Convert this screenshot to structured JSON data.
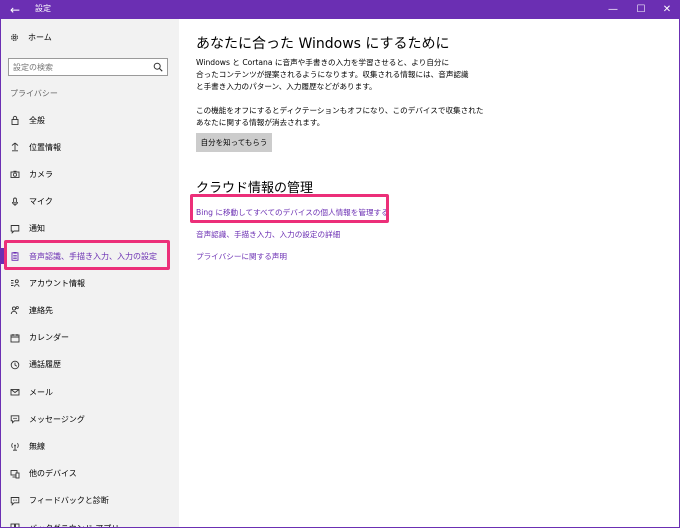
{
  "window": {
    "title": "設定",
    "back_icon": "back-arrow-icon",
    "minimize_icon": "minimize-icon",
    "maximize_icon": "maximize-icon",
    "close_icon": "close-icon",
    "accent": "#6b2fb3",
    "highlight_color": "#ec2f79"
  },
  "sidebar": {
    "home_label": "ホーム",
    "search_placeholder": "設定の検索",
    "section_label": "プライバシー",
    "items": [
      {
        "label": "全般",
        "icon": "lock-icon"
      },
      {
        "label": "位置情報",
        "icon": "location-icon"
      },
      {
        "label": "カメラ",
        "icon": "camera-icon"
      },
      {
        "label": "マイク",
        "icon": "microphone-icon"
      },
      {
        "label": "通知",
        "icon": "notification-icon"
      },
      {
        "label": "音声認識、手描き入力、入力の設定",
        "icon": "clipboard-icon",
        "selected": true
      },
      {
        "label": "アカウント情報",
        "icon": "account-info-icon"
      },
      {
        "label": "連絡先",
        "icon": "contacts-icon"
      },
      {
        "label": "カレンダー",
        "icon": "calendar-icon"
      },
      {
        "label": "通話履歴",
        "icon": "call-history-icon"
      },
      {
        "label": "メール",
        "icon": "mail-icon"
      },
      {
        "label": "メッセージング",
        "icon": "messaging-icon"
      },
      {
        "label": "無線",
        "icon": "radio-icon"
      },
      {
        "label": "他のデバイス",
        "icon": "devices-icon"
      },
      {
        "label": "フィードバックと診断",
        "icon": "feedback-icon"
      },
      {
        "label": "バックグラウンド アプリ",
        "icon": "background-apps-icon"
      }
    ]
  },
  "main": {
    "heading": "あなたに合った Windows にするために",
    "para1": [
      "Windows と Cortana に音声や手書きの入力を学習させると、より自分に",
      "合ったコンテンツが提案されるようになります。収集される情報には、音声認識",
      "と手書き入力のパターン、入力履歴などがあります。"
    ],
    "para2": [
      "この機能をオフにするとディクテーションもオフになり、このデバイスで収集された",
      "あなたに関する情報が消去されます。"
    ],
    "button_label": "自分を知ってもらう",
    "section2_heading": "クラウド情報の管理",
    "links": [
      "Bing に移動してすべてのデバイスの個人情報を管理する",
      "音声認識、手描き入力、入力の設定の詳細",
      "プライバシーに関する声明"
    ]
  }
}
